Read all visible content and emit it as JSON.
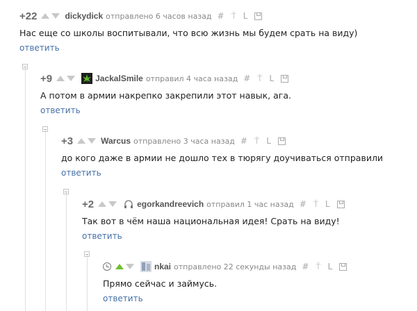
{
  "reply_label": "ответить",
  "colors": {
    "link": "#4470a8",
    "rating": "#6b6b6b",
    "vote_inactive": "#c8c8c8",
    "vote_active": "#6fbf2e",
    "author": "#555555",
    "meta": "#888888"
  },
  "tool_icons": [
    "hash-icon",
    "pin-icon",
    "reply-branch-icon",
    "save-icon"
  ],
  "comments": [
    {
      "rating": "+22",
      "author": "dickydick",
      "time": "отправлено 6 часов назад",
      "text": "Нас еще со школы воспитывали, что всю жизнь мы будем срать на виду)"
    },
    {
      "rating": "+9",
      "author": "JackalSmile",
      "time": "отправил 4 часа назад",
      "text": "А потом в армии накрепко закрепили этот навык, ага."
    },
    {
      "rating": "+3",
      "author": "Warcus",
      "time": "отправлено 3 часа назад",
      "text": "до кого даже в армии не дошло тех в тюрягу доучиваться отправили"
    },
    {
      "rating": "+2",
      "author": "egorkandreevich",
      "time": "отправил 1 час назад",
      "text": "Так вот в чём наша национальная идея! Срать на виду!"
    },
    {
      "rating": "",
      "author": "nkai",
      "time": "отправлено 22 секунды назад",
      "text": "Прямо сейчас и займусь."
    }
  ]
}
